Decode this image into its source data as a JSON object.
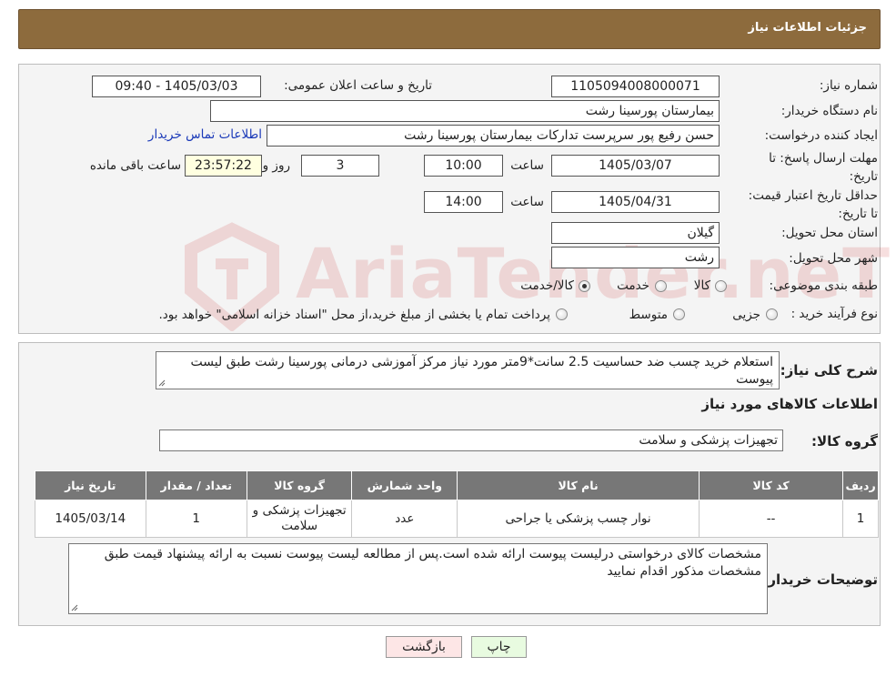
{
  "header": {
    "title": "جزئیات اطلاعات نیاز"
  },
  "form": {
    "need_number_label": "شماره نیاز:",
    "need_number": "1105094008000071",
    "announce_label": "تاریخ و ساعت اعلان عمومی:",
    "announce_value": "1405/03/03 - 09:40",
    "buyer_org_label": "نام دستگاه خریدار:",
    "buyer_org": "بیمارستان پورسینا رشت",
    "creator_label": "ایجاد کننده درخواست:",
    "creator": "حسن رفیع پور سرپرست تدارکات بیمارستان پورسینا رشت",
    "contact_link": "اطلاعات تماس خریدار",
    "deadline_label": "مهلت ارسال پاسخ: تا تاریخ:",
    "deadline_date": "1405/03/07",
    "time_label": "ساعت",
    "deadline_time": "10:00",
    "days": "3",
    "days_label": "روز و",
    "remaining": "23:57:22",
    "remaining_label": "ساعت باقی مانده",
    "validity_label": "حداقل تاریخ اعتبار قیمت: تا تاریخ:",
    "validity_date": "1405/04/31",
    "validity_time": "14:00",
    "province_label": "استان محل تحویل:",
    "province": "گیلان",
    "city_label": "شهر محل تحویل:",
    "city": "رشت",
    "category_label": "طبقه بندی موضوعی:",
    "category_options": [
      "کالا",
      "خدمت",
      "کالا/خدمت"
    ],
    "process_label": "نوع فرآیند خرید :",
    "process_options": [
      "جزیی",
      "متوسط"
    ],
    "process_note": "پرداخت تمام یا بخشی از مبلغ خرید،از محل \"اسناد خزانه اسلامی\" خواهد بود."
  },
  "details": {
    "summary_label": "شرح کلی نیاز:",
    "summary": "استعلام خرید چسب ضد حساسیت 2.5 سانت*9متر مورد نیاز مرکز آموزشی درمانی پورسینا رشت طبق لیست پیوست",
    "goods_info_title": "اطلاعات کالاهای مورد نیاز",
    "goods_group_label": "گروه کالا:",
    "goods_group": "تجهیزات پزشکی و سلامت",
    "table": {
      "headers": [
        "ردیف",
        "کد کالا",
        "نام کالا",
        "واحد شمارش",
        "گروه کالا",
        "تعداد / مقدار",
        "تاریخ نیاز"
      ],
      "rows": [
        [
          "1",
          "--",
          "نوار چسب پزشکی یا جراحی",
          "عدد",
          "تجهیزات پزشکی و سلامت",
          "1",
          "1405/03/14"
        ]
      ]
    },
    "buyer_notes_label": "توضیحات خریدار:",
    "buyer_notes": "مشخصات کالای درخواستی درلیست پیوست ارائه شده است.پس از مطالعه لیست پیوست نسبت به ارائه پیشنهاد قیمت طبق مشخصات مذکور اقدام نمایید"
  },
  "buttons": {
    "print": "چاپ",
    "back": "بازگشت"
  },
  "watermark": {
    "text": "AriaTender.neT"
  },
  "colors": {
    "header": "#8d6b3d",
    "print_btn": "#e8fbe0",
    "back_btn": "#fde6e6"
  }
}
